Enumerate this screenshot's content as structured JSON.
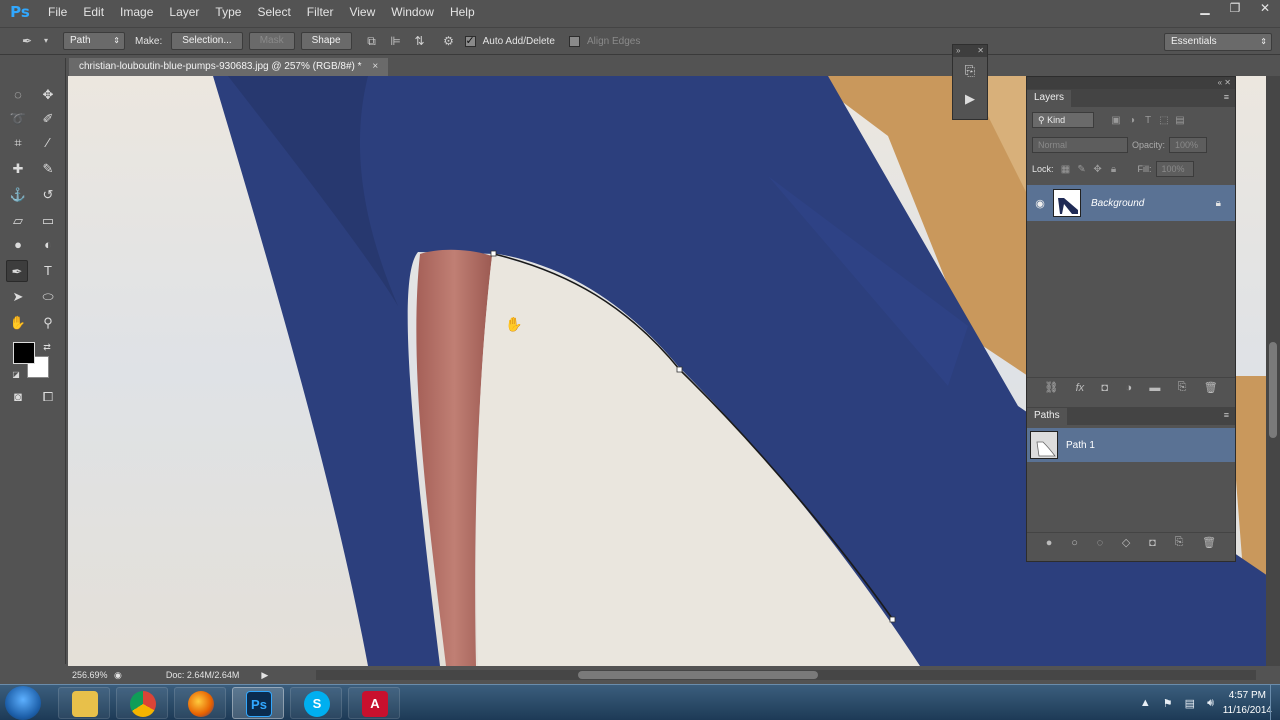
{
  "app": {
    "logo": "Ps",
    "menu": [
      "File",
      "Edit",
      "Image",
      "Layer",
      "Type",
      "Select",
      "Filter",
      "View",
      "Window",
      "Help"
    ],
    "window_controls": {
      "minimize": "▁",
      "restore": "❐",
      "close": "✕"
    }
  },
  "options_bar": {
    "tool_mode": "Path",
    "make_label": "Make:",
    "selection_btn": "Selection...",
    "mask_btn": "Mask",
    "shape_btn": "Shape",
    "auto_add_delete": {
      "label": "Auto Add/Delete",
      "checked": true
    },
    "align_edges": {
      "label": "Align Edges",
      "checked": false
    },
    "workspace": "Essentials"
  },
  "document": {
    "tab_title": "christian-louboutin-blue-pumps-930683.jpg @ 257% (RGB/8#) *",
    "close": "×"
  },
  "status": {
    "zoom": "256.69%",
    "doc_info": "Doc: 2.64M/2.64M"
  },
  "layers_panel": {
    "tab": "Layers",
    "filter": "Kind",
    "blend_mode": "Normal",
    "opacity_label": "Opacity:",
    "opacity_value": "100%",
    "lock_label": "Lock:",
    "fill_label": "Fill:",
    "fill_value": "100%",
    "layers": [
      {
        "name": "Background",
        "visible": true,
        "locked": true
      }
    ]
  },
  "paths_panel": {
    "tab": "Paths",
    "paths": [
      {
        "name": "Path 1"
      }
    ]
  },
  "taskbar": {
    "apps": [
      "explorer",
      "chrome",
      "firefox",
      "photoshop",
      "skype",
      "adobe-reader"
    ],
    "app_glyphs": {
      "photoshop": "Ps",
      "skype": "S",
      "adobe-reader": "A"
    },
    "clock_time": "4:57 PM",
    "clock_date": "11/16/2014"
  },
  "colors": {
    "shoe_blue": "#2c3f7d",
    "sole_red": "#b06a62",
    "background": "#e8e2d8",
    "selection_blue": "#5a7294",
    "ps_accent": "#31a8ff"
  }
}
